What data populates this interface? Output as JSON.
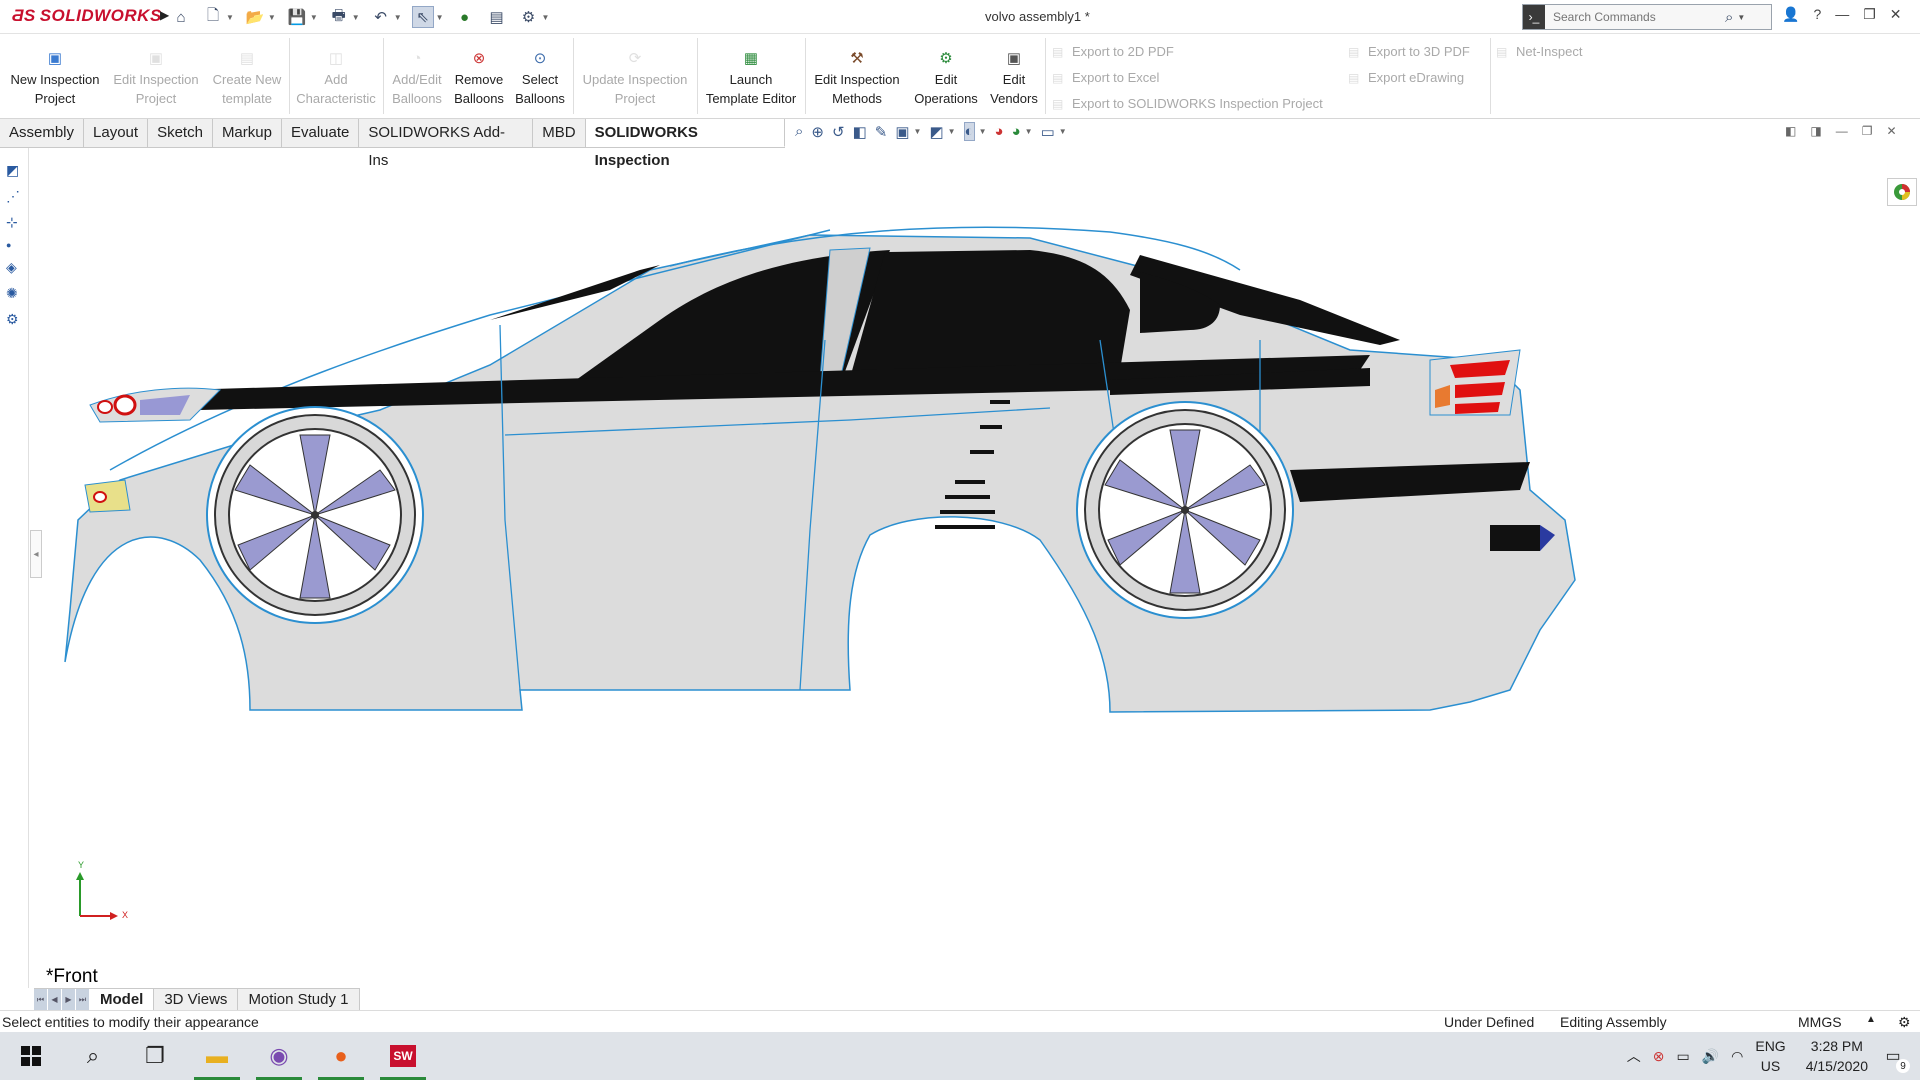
{
  "app": {
    "brand": "SOLIDWORKS",
    "document_title": "volvo assembly1 *"
  },
  "search": {
    "placeholder": "Search Commands"
  },
  "quick_access_icons": [
    "home-icon",
    "new-document-icon",
    "open-folder-icon",
    "save-icon",
    "print-icon",
    "undo-icon",
    "select-arrow-icon",
    "traffic-light-icon",
    "file-properties-icon",
    "options-gear-icon"
  ],
  "ribbon": {
    "new_project": "New Inspection Project",
    "edit_project": "Edit Inspection Project",
    "create_template": "Create New template",
    "add_characteristic": "Add Characteristic",
    "add_edit_balloons": "Add/Edit Balloons",
    "remove_balloons": "Remove Balloons",
    "select_balloons": "Select Balloons",
    "update_project": "Update Inspection Project",
    "launch_template_editor": "Launch Template Editor",
    "edit_methods": "Edit Inspection Methods",
    "edit_operations": "Edit Operations",
    "edit_vendors": "Edit Vendors",
    "export_2d_pdf": "Export to 2D PDF",
    "export_excel": "Export to Excel",
    "export_sw_inspection": "Export to SOLIDWORKS Inspection Project",
    "export_3d_pdf": "Export to 3D PDF",
    "export_edrawing": "Export eDrawing",
    "net_inspect": "Net-Inspect"
  },
  "tabs": [
    "Assembly",
    "Layout",
    "Sketch",
    "Markup",
    "Evaluate",
    "SOLIDWORKS Add-Ins",
    "MBD",
    "SOLIDWORKS Inspection"
  ],
  "active_tab": "SOLIDWORKS Inspection",
  "viewport": {
    "view_label": "*Front",
    "triad_y": "Y",
    "triad_x": "X"
  },
  "bottom_tabs": [
    "Model",
    "3D Views",
    "Motion Study 1"
  ],
  "status": {
    "message": "Select entities to modify their appearance",
    "definition": "Under Defined",
    "mode": "Editing Assembly",
    "units": "MMGS"
  },
  "taskbar": {
    "apps": [
      "windows-start-icon",
      "search-icon",
      "task-view-icon",
      "file-explorer-icon",
      "tor-browser-icon",
      "firefox-icon",
      "solidworks-2020-icon"
    ],
    "lang_line1": "ENG",
    "lang_line2": "US",
    "time": "3:28 PM",
    "date": "4/15/2020",
    "notifications": "9"
  },
  "colors": {
    "brand_red": "#c8102e",
    "edge_blue": "#2b8fd0",
    "stripe": "#111111",
    "wheel_spoke": "#9a9ad0",
    "taillight": "#e01010"
  }
}
